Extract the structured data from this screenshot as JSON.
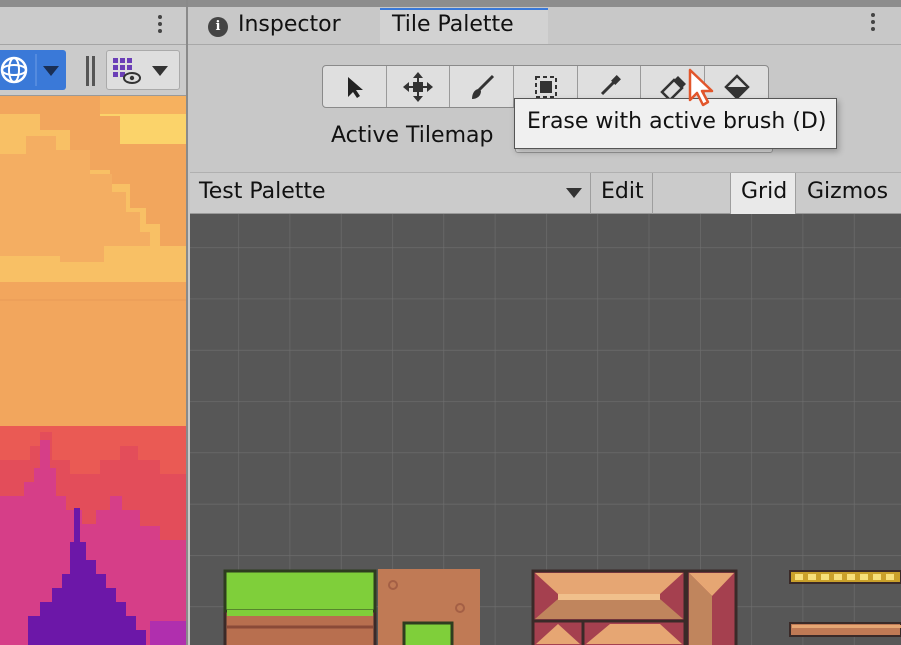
{
  "window": {
    "tabs": [
      {
        "label": "Inspector",
        "active": false
      },
      {
        "label": "Tile Palette",
        "active": true
      }
    ],
    "accent_color": "#3a79d8"
  },
  "scene_panel": {
    "icons": [
      "kebab-menu-icon",
      "orbit-gizmo-icon",
      "chevron-down-icon",
      "visibility-grid-icon"
    ],
    "scene_colors": [
      "#fbd36a",
      "#f2a65d",
      "#ea5a54",
      "#d63e88",
      "#6c17a8"
    ]
  },
  "tile_palette": {
    "tools": [
      {
        "name": "select-tool",
        "icon": "arrow-icon"
      },
      {
        "name": "move-tool",
        "icon": "move-arrows-icon"
      },
      {
        "name": "paint-tool",
        "icon": "brush-icon"
      },
      {
        "name": "box-fill-tool",
        "icon": "box-icon"
      },
      {
        "name": "picker-tool",
        "icon": "eyedropper-icon"
      },
      {
        "name": "erase-tool",
        "icon": "eraser-icon"
      },
      {
        "name": "fill-tool",
        "icon": "bucket-icon"
      }
    ],
    "active_tilemap_label": "Active Tilemap",
    "tooltip": "Erase with active brush (D)",
    "palette_name": "Test Palette",
    "edit_label": "Edit",
    "grid_label": "Grid",
    "gizmos_label": "Gizmos"
  }
}
